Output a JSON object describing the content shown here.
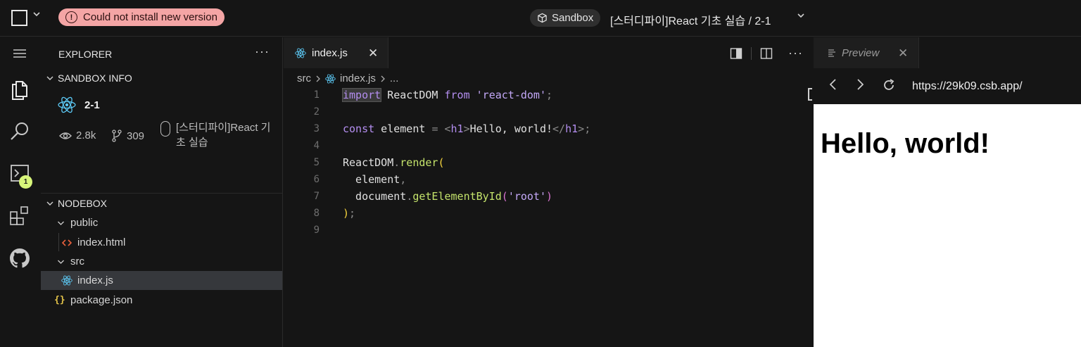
{
  "topbar": {
    "error_text": "Could not install new version",
    "sandbox_label": "Sandbox",
    "title": "[스터디파이]React 기초 실습 / 2-1"
  },
  "activity": {
    "badge_count": "1",
    "icons": [
      "menu-icon",
      "files-icon",
      "search-icon",
      "terminal-icon",
      "extensions-icon",
      "github-icon"
    ]
  },
  "sidebar": {
    "header": "EXPLORER",
    "more": "···",
    "sandbox_info": {
      "title": "SANDBOX INFO",
      "project_name": "2-1",
      "views": "2.8k",
      "forks": "309",
      "description": "[스터디파이]React 기초 실습"
    },
    "nodebox": {
      "title": "NODEBOX",
      "items": [
        {
          "label": "public",
          "kind": "folder"
        },
        {
          "label": "index.html",
          "kind": "html"
        },
        {
          "label": "src",
          "kind": "folder"
        },
        {
          "label": "index.js",
          "kind": "js"
        },
        {
          "label": "package.json",
          "kind": "json"
        }
      ]
    }
  },
  "editor": {
    "tab_label": "index.js",
    "breadcrumb": [
      "src",
      "index.js",
      "..."
    ],
    "line_numbers": [
      "1",
      "2",
      "3",
      "4",
      "5",
      "6",
      "7",
      "8",
      "9"
    ]
  },
  "preview": {
    "tab_label": "Preview",
    "url": "https://29k09.csb.app/",
    "heading": "Hello, world!"
  },
  "colors": {
    "background": "#151515",
    "error_pill": "#f4a5a5",
    "badge": "#d7f57a",
    "keyword": "#b48ef0",
    "function": "#c4e36b",
    "react_icon": "#5cc9f5"
  }
}
